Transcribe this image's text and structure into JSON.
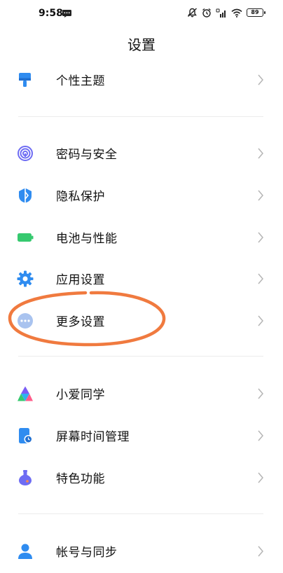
{
  "status_bar": {
    "time": "9:58",
    "battery": "89"
  },
  "header": {
    "title": "设置"
  },
  "sections": [
    {
      "items": [
        {
          "label": "个性主题",
          "icon": "theme-brush-icon",
          "color": "#2f8cf0"
        }
      ]
    },
    {
      "items": [
        {
          "label": "密码与安全",
          "icon": "fingerprint-icon",
          "color": "#6e6cf3"
        },
        {
          "label": "隐私保护",
          "icon": "privacy-shield-icon",
          "color": "#2f8cf0"
        },
        {
          "label": "电池与性能",
          "icon": "battery-icon",
          "color": "#36c96f"
        },
        {
          "label": "应用设置",
          "icon": "gear-icon",
          "color": "#2f8cf0"
        },
        {
          "label": "更多设置",
          "icon": "more-dots-icon",
          "color": "#a9c3ef"
        }
      ]
    },
    {
      "items": [
        {
          "label": "小爱同学",
          "icon": "xiaoai-icon",
          "color": "#7a5cf5"
        },
        {
          "label": "屏幕时间管理",
          "icon": "screen-time-icon",
          "color": "#2f8cf0"
        },
        {
          "label": "特色功能",
          "icon": "special-feature-icon",
          "color": "#6e6cf3"
        }
      ]
    },
    {
      "items": [
        {
          "label": "帐号与同步",
          "icon": "account-icon",
          "color": "#2f8cf0"
        }
      ]
    }
  ],
  "annotation_color": "#f07a3f"
}
